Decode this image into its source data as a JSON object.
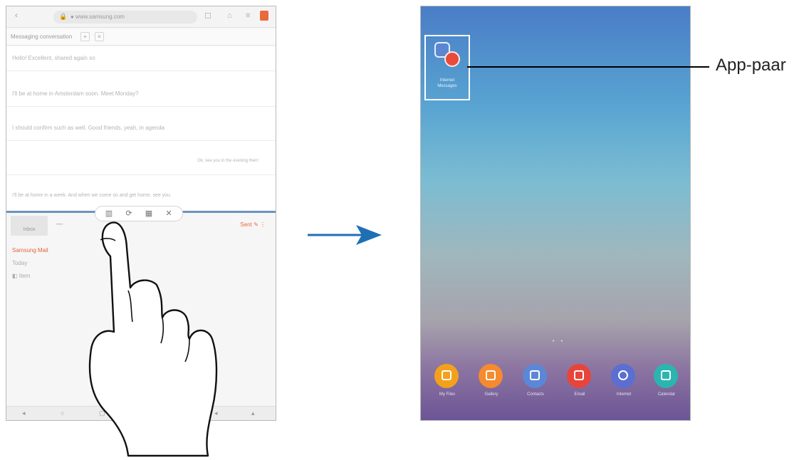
{
  "left_tablet": {
    "browser": {
      "back_icon": "back-arrow-icon",
      "url": "● www.samsung.com",
      "url_icon": "lock-icon",
      "tab_count": "☐",
      "share_icon": "share-icon",
      "bookmark_icon": "star-icon",
      "menu_icon": "menu-icon"
    },
    "messages": {
      "header": "Messaging conversation",
      "header_chip_add": "+",
      "header_chip_close": "×",
      "lines": [
        "Hello! Excellent, shared again so",
        "I'll be at home in Amsterdam soon. Meet Monday?",
        "I should confirm such as well. Good friends, yeah, in agenda",
        "Ok, see you in the evening then!",
        "I'll be at home in a week. And when we come so and get home, see you"
      ]
    },
    "split_controls": {
      "icons": [
        "split-view-icon",
        "swap-icon",
        "app-pair-icon",
        "close-icon"
      ],
      "glyphs": [
        "▥",
        "⟳",
        "▦",
        "✕"
      ]
    },
    "bottom_app": {
      "tab1": "Inbox",
      "tab2": "—",
      "right_action": "Sent  ✎  ⋮",
      "lines": [
        "Samsung Mail",
        "Today",
        "◧ Item"
      ]
    },
    "nav_bar": [
      "◂",
      "○",
      "▢",
      "◂",
      "▴"
    ]
  },
  "arrow": {
    "color": "#1f6fb5"
  },
  "right_tablet": {
    "app_pair": {
      "label_line1": "Internet",
      "label_line2": "Messages"
    },
    "page_dots": "• •",
    "dock_apps": [
      {
        "label": "My Files",
        "color": "#f3a11c"
      },
      {
        "label": "Gallery",
        "color": "#f58a2e"
      },
      {
        "label": "Contacts",
        "color": "#5c87d6"
      },
      {
        "label": "Email",
        "color": "#e8453a"
      },
      {
        "label": "Internet",
        "color": "#5a6fd1"
      },
      {
        "label": "Calendar",
        "color": "#2bb5b0"
      }
    ]
  },
  "callout": {
    "label": "App-paar"
  }
}
